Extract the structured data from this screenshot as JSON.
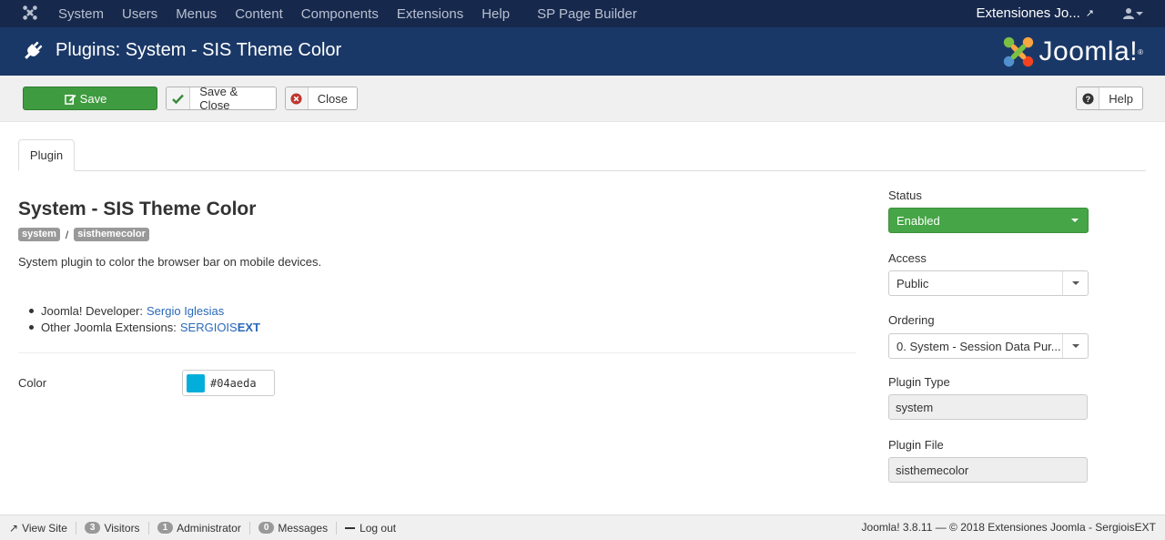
{
  "navbar": {
    "menu": [
      "System",
      "Users",
      "Menus",
      "Content",
      "Components",
      "Extensions",
      "Help"
    ],
    "extra_menu": "SP Page Builder",
    "site_name": "Extensiones Jo...",
    "user_icon": "user-icon"
  },
  "header": {
    "title": "Plugins: System - SIS Theme Color",
    "logo_text": "Joomla!",
    "registered": "®"
  },
  "toolbar": {
    "save_label": "Save",
    "save_close_label": "Save & Close",
    "close_label": "Close",
    "help_label": "Help"
  },
  "tabs": {
    "plugin": "Plugin"
  },
  "main": {
    "title": "System - SIS Theme Color",
    "badge_group": "system",
    "badge_slash": "/",
    "badge_element": "sisthemecolor",
    "description": "System plugin to color the browser bar on mobile devices.",
    "developer_label": "Joomla! Developer:",
    "developer_link": "Sergio Iglesias",
    "other_label": "Other Joomla Extensions:",
    "other_link_a": "SERGIOIS",
    "other_link_b": "EXT",
    "color_label": "Color",
    "color_value": "#04aeda"
  },
  "sidebar": {
    "status_label": "Status",
    "status_value": "Enabled",
    "access_label": "Access",
    "access_value": "Public",
    "ordering_label": "Ordering",
    "ordering_value": "0. System - Session Data Pur...",
    "type_label": "Plugin Type",
    "type_value": "system",
    "file_label": "Plugin File",
    "file_value": "sisthemecolor"
  },
  "footer": {
    "view_site": "View Site",
    "visitors_count": "3",
    "visitors_label": "Visitors",
    "admin_count": "1",
    "admin_label": "Administrator",
    "messages_count": "0",
    "messages_label": "Messages",
    "logout": "Log out",
    "copyright": "Joomla! 3.8.11 — © 2018 Extensiones Joomla - SergioisEXT"
  },
  "colors": {
    "navbar_bg": "#17284d",
    "header_bg": "#1a3867",
    "save_green": "#3f9b3f",
    "status_green": "#46a546",
    "link_blue": "#2a69b8",
    "theme_color": "#04aeda"
  }
}
